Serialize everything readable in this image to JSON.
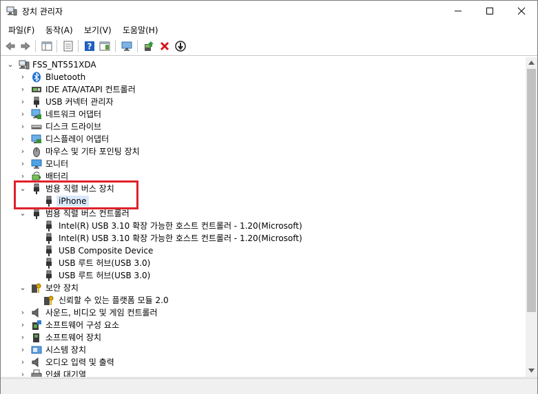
{
  "window": {
    "title": "장치 관리자"
  },
  "menu": {
    "items": [
      "파일(F)",
      "동작(A)",
      "보기(V)",
      "도움말(H)"
    ]
  },
  "toolbar": {
    "buttons": [
      "back-icon",
      "forward-icon",
      "properties-icon",
      "properties-pane-icon",
      "help-icon",
      "console-icon",
      "monitor-icon",
      "update-driver-icon",
      "uninstall-icon",
      "disable-icon"
    ]
  },
  "tree": {
    "root": "FSS_NT551XDA",
    "nodes": [
      "Bluetooth",
      "IDE ATA/ATAPI 컨트롤러",
      "USB 커넥터 관리자",
      "네트워크 어댑터",
      "디스크 드라이브",
      "디스플레이 어댑터",
      "마우스 및 기타 포인팅 장치",
      "모니터",
      "배터리",
      "범용 직렬 버스 장치",
      "iPhone",
      "범용 직렬 버스 컨트롤러",
      "Intel(R) USB 3.10 확장 가능한 호스트 컨트롤러 - 1.20(Microsoft)",
      "Intel(R) USB 3.10 확장 가능한 호스트 컨트롤러 - 1.20(Microsoft)",
      "USB Composite Device",
      "USB 루트 허브(USB 3.0)",
      "USB 루트 허브(USB 3.0)",
      "보안 장치",
      "신뢰할 수 있는 플랫폼 모듈 2.0",
      "사운드, 비디오 및 게임 컨트롤러",
      "소프트웨어 구성 요소",
      "소프트웨어 장치",
      "시스템 장치",
      "오디오 입력 및 출력",
      "인쇄 대기열"
    ]
  },
  "colors": {
    "highlight": "#e0202a",
    "selection": "#d9e8fb"
  }
}
